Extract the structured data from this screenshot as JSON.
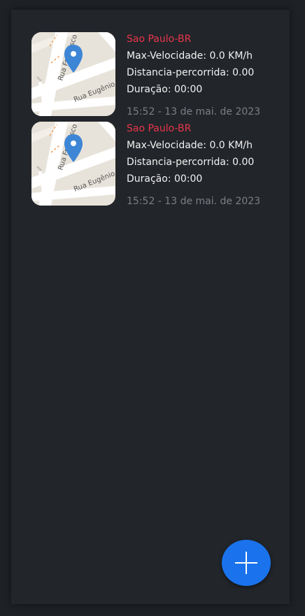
{
  "trips": [
    {
      "city": "Sao Paulo-BR",
      "max_speed": "Max-Velocidade: 0.0 KM/h",
      "distance": "Distancia-percorrida: 0.00",
      "duration": "Duração: 00:00",
      "timestamp": "15:52 - 13 de mai. de 2023",
      "map_labels": {
        "street_top": "Rua Francisco",
        "street_bottom": "Rua Eugênio"
      }
    },
    {
      "city": "Sao Paulo-BR",
      "max_speed": "Max-Velocidade: 0.0 KM/h",
      "distance": "Distancia-percorrida: 0.00",
      "duration": "Duração: 00:00",
      "timestamp": "15:52 - 13 de mai. de 2023",
      "map_labels": {
        "street_top": "Rua Francisco",
        "street_bottom": "Rua Eugênio"
      }
    }
  ],
  "fab": {
    "icon": "plus-icon"
  },
  "colors": {
    "background": "#22252a",
    "city": "#e8364b",
    "text": "#f2f2f2",
    "timestamp": "#7c7f84",
    "fab": "#1a73ec",
    "pin": "#3d86d6"
  }
}
